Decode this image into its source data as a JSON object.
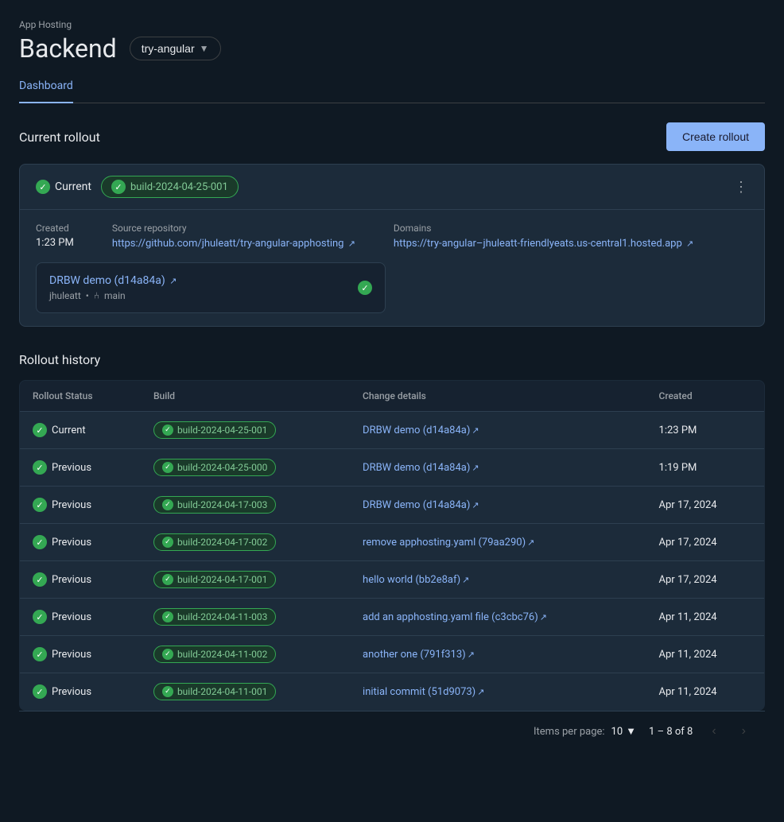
{
  "app": {
    "hosting_label": "App Hosting",
    "title": "Backend",
    "branch_selector": {
      "label": "try-angular"
    }
  },
  "tabs": [
    {
      "label": "Dashboard",
      "active": true
    }
  ],
  "current_rollout": {
    "section_title": "Current rollout",
    "create_button": "Create rollout",
    "status": "Current",
    "build_id": "build-2024-04-25-001",
    "three_dots": "⋮",
    "created_label": "Created",
    "created_value": "1:23 PM",
    "source_repo_label": "Source repository",
    "source_repo_url": "https://github.com/jhuleatt/try-angular-apphosting",
    "domains_label": "Domains",
    "domains_url": "https://try-angular–jhuleatt-friendlyeats.us-central1.hosted.app",
    "commit_link": "DRBW demo (d14a84a)",
    "commit_user": "jhuleatt",
    "commit_branch": "main"
  },
  "rollout_history": {
    "title": "Rollout history",
    "columns": [
      "Rollout Status",
      "Build",
      "Change details",
      "Created"
    ],
    "rows": [
      {
        "status": "Current",
        "build": "build-2024-04-25-001",
        "change": "DRBW demo (d14a84a)",
        "created": "1:23 PM"
      },
      {
        "status": "Previous",
        "build": "build-2024-04-25-000",
        "change": "DRBW demo (d14a84a)",
        "created": "1:19 PM"
      },
      {
        "status": "Previous",
        "build": "build-2024-04-17-003",
        "change": "DRBW demo (d14a84a)",
        "created": "Apr 17, 2024"
      },
      {
        "status": "Previous",
        "build": "build-2024-04-17-002",
        "change": "remove apphosting.yaml (79aa290)",
        "created": "Apr 17, 2024"
      },
      {
        "status": "Previous",
        "build": "build-2024-04-17-001",
        "change": "hello world (bb2e8af)",
        "created": "Apr 17, 2024"
      },
      {
        "status": "Previous",
        "build": "build-2024-04-11-003",
        "change": "add an apphosting.yaml file (c3cbc76)",
        "created": "Apr 11, 2024"
      },
      {
        "status": "Previous",
        "build": "build-2024-04-11-002",
        "change": "another one (791f313)",
        "created": "Apr 11, 2024"
      },
      {
        "status": "Previous",
        "build": "build-2024-04-11-001",
        "change": "initial commit (51d9073)",
        "created": "Apr 11, 2024"
      }
    ]
  },
  "pagination": {
    "items_per_page_label": "Items per page:",
    "items_per_page_value": "10",
    "page_info": "1 – 8 of 8"
  }
}
